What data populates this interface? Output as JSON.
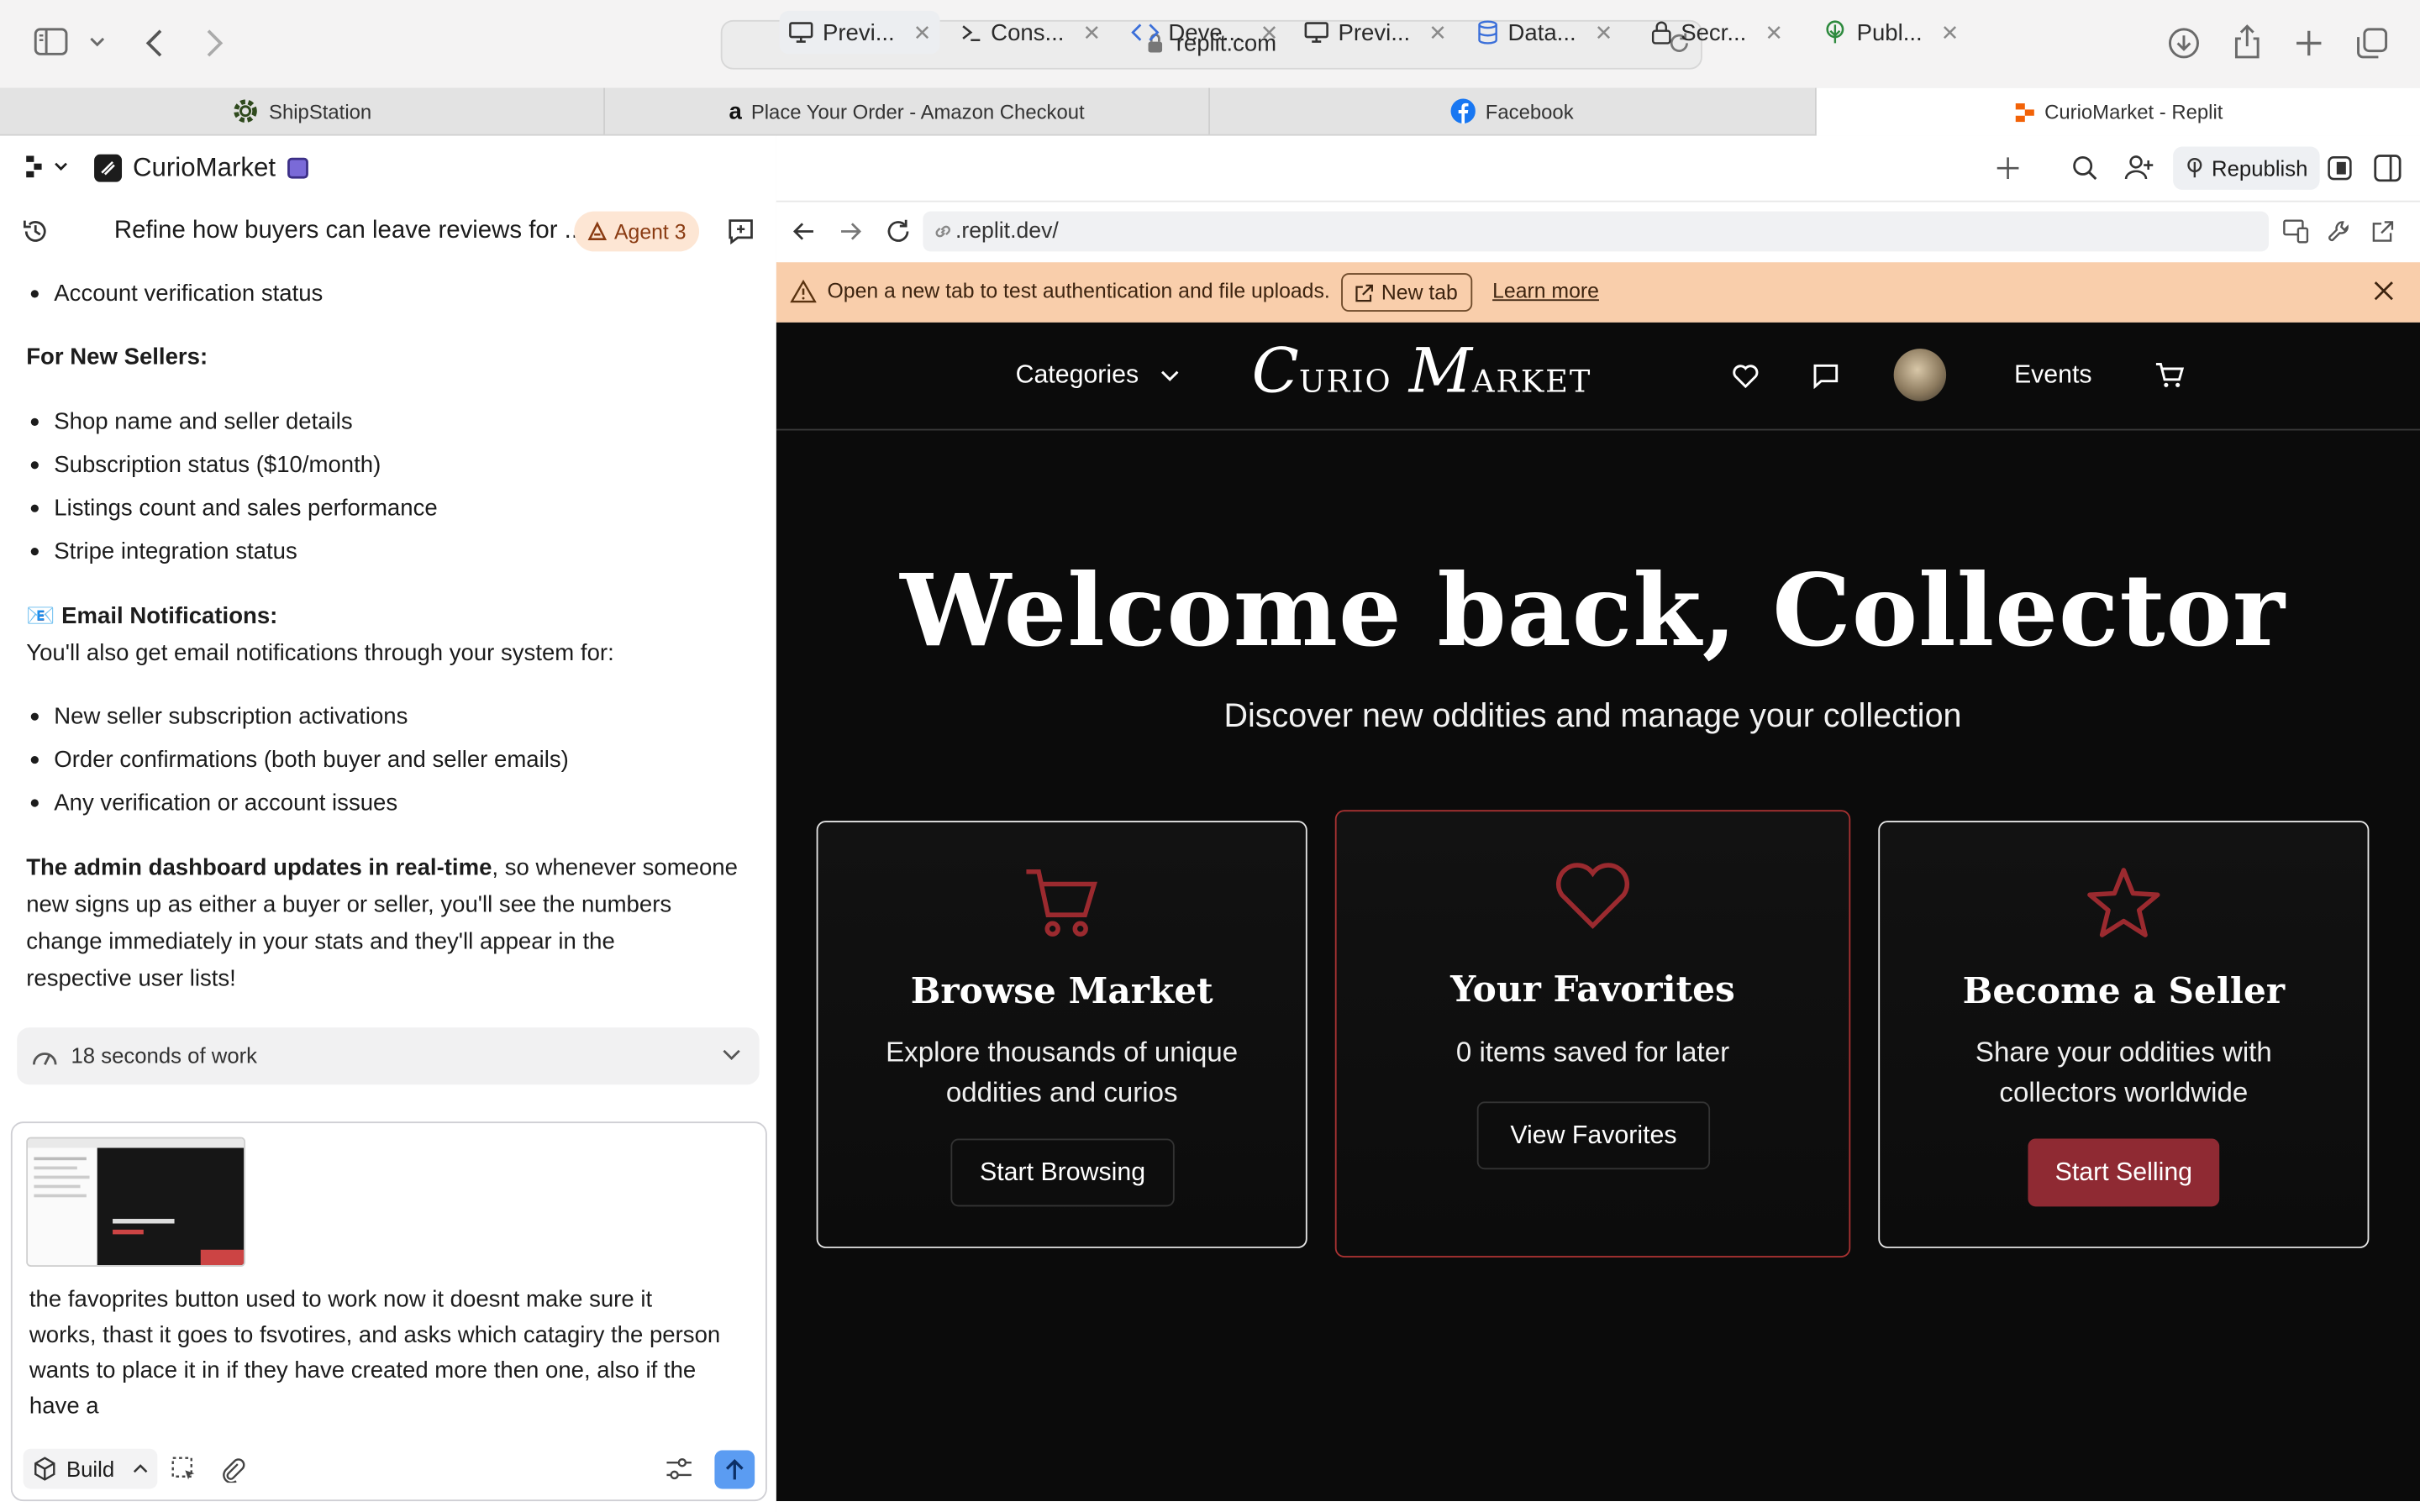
{
  "browser": {
    "url": "replit.com",
    "tabs": [
      {
        "label": "ShipStation"
      },
      {
        "label": "Place Your Order - Amazon Checkout"
      },
      {
        "label": "Facebook"
      },
      {
        "label": "CurioMarket - Replit"
      }
    ]
  },
  "project": {
    "name": "CurioMarket"
  },
  "agent": {
    "thread_title": "Refine how buyers can leave reviews for ...",
    "badge": "Agent 3",
    "messages": {
      "bullet_prev": "Account verification status",
      "new_sellers_heading": "For New Sellers:",
      "seller_bullets": [
        "Shop name and seller details",
        "Subscription status ($10/month)",
        "Listings count and sales performance",
        "Stripe integration status"
      ],
      "email_heading": "📧 Email Notifications:",
      "email_intro": "You'll also get email notifications through your system for:",
      "email_bullets": [
        "New seller subscription activations",
        "Order confirmations (both buyer and seller emails)",
        "Any verification or account issues"
      ],
      "summary_bold": "The admin dashboard updates in real-time",
      "summary_line1": ", so whenever someone",
      "summary_line2": "new signs up as either a buyer or seller, you'll see the numbers",
      "summary_line3": "change immediately in your stats and they'll appear in the",
      "summary_line4": "respective user lists!"
    },
    "work_summary": "18 seconds of work",
    "composer": {
      "text_lines": [
        "the favoprites button used to work now it doesnt make sure it",
        "works, thast it goes to fsvotires, and asks which catagiry the person",
        "wants to place it in if they have created more then one, also if the",
        "have a"
      ],
      "mode": "Build"
    }
  },
  "workspace": {
    "tabs": [
      {
        "label": "Previ...",
        "icon": "monitor-icon"
      },
      {
        "label": "Cons...",
        "icon": "terminal-icon"
      },
      {
        "label": "Deve...",
        "icon": "code-icon"
      },
      {
        "label": "Previ...",
        "icon": "monitor-icon"
      },
      {
        "label": "Data...",
        "icon": "database-icon"
      },
      {
        "label": "Secr...",
        "icon": "lock-icon"
      },
      {
        "label": "Publ...",
        "icon": "publish-icon"
      }
    ],
    "republish": "Republish",
    "preview_url": ".replit.dev/",
    "warning": {
      "text": "Open a new tab to test authentication and file uploads.",
      "new_tab": "New tab",
      "learn_more": "Learn more"
    }
  },
  "site": {
    "nav": {
      "categories": "Categories",
      "logo_first": "C",
      "logo_rest1": "URIO",
      "logo_m": "M",
      "logo_rest2": "ARKET",
      "events": "Events"
    },
    "hero_title": "Welcome back, Collector",
    "hero_subtitle": "Discover new oddities and manage your collection",
    "cards": [
      {
        "title": "Browse Market",
        "desc1": "Explore thousands of unique",
        "desc2": "oddities and curios",
        "button": "Start Browsing",
        "icon": "cart-icon"
      },
      {
        "title": "Your Favorites",
        "desc1": "0 items saved for later",
        "desc2": "",
        "button": "View Favorites",
        "icon": "heart-icon"
      },
      {
        "title": "Become a Seller",
        "desc1": "Share your oddities with",
        "desc2": "collectors worldwide",
        "button": "Start Selling",
        "icon": "star-icon"
      }
    ],
    "accent": "#8f2a33"
  }
}
